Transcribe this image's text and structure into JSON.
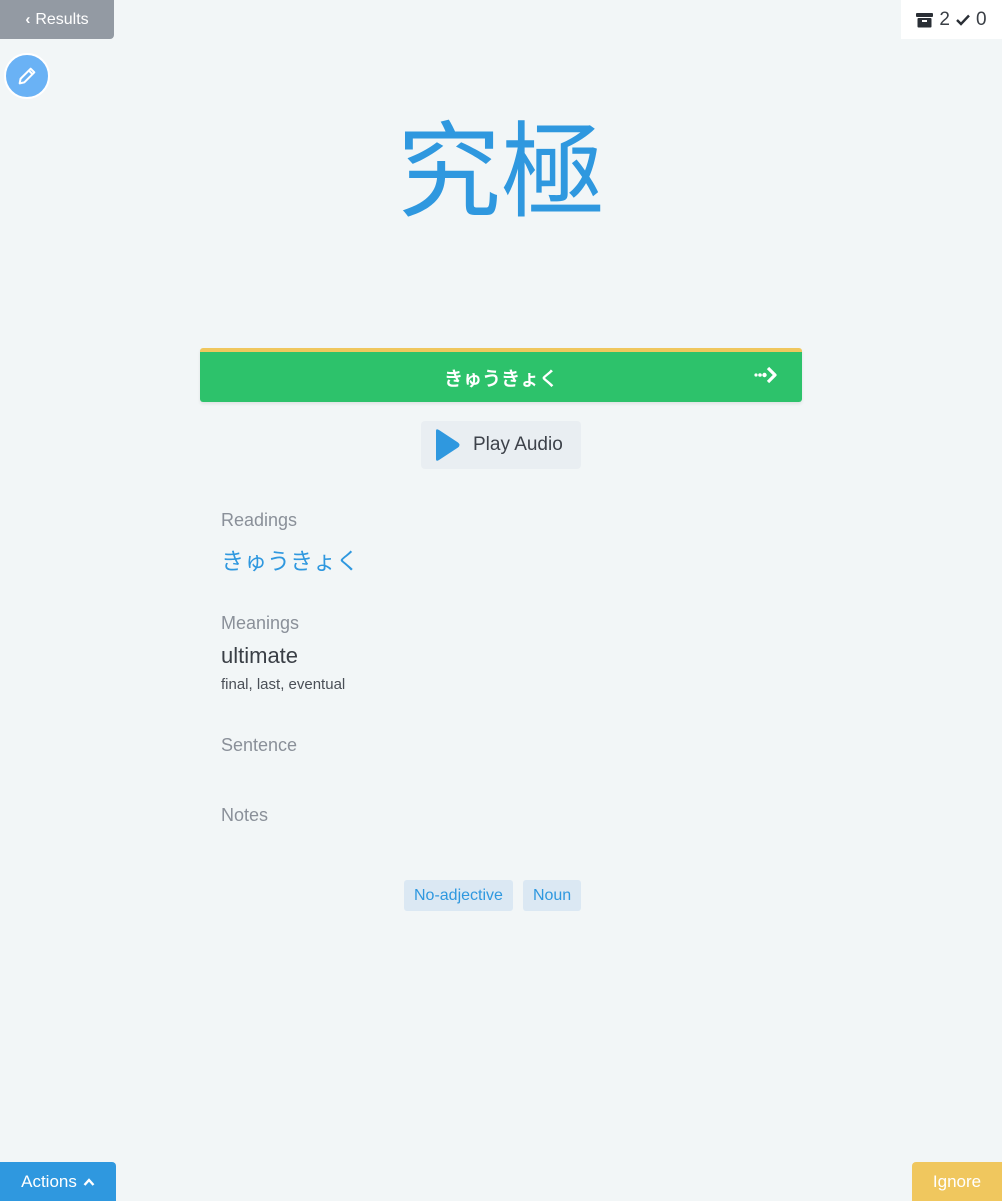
{
  "nav": {
    "back_label": "Results"
  },
  "counters": {
    "archive_count": "2",
    "check_count": "0"
  },
  "word": {
    "kanji": "究極"
  },
  "answer": {
    "text": "きゅうきょく"
  },
  "audio": {
    "label": "Play Audio"
  },
  "sections": {
    "readings_label": "Readings",
    "reading_value": "きゅうきょく",
    "meanings_label": "Meanings",
    "meaning_main": "ultimate",
    "meaning_alt": "final, last, eventual",
    "sentence_label": "Sentence",
    "notes_label": "Notes"
  },
  "tags": [
    {
      "label": "No-adjective"
    },
    {
      "label": "Noun"
    }
  ],
  "footer": {
    "actions_label": "Actions",
    "ignore_label": "Ignore"
  },
  "colors": {
    "accent_blue": "#2f98df",
    "answer_green": "#2dc26b",
    "warning_yellow": "#f0c75e",
    "back_gray": "#939aa3"
  },
  "icons": {
    "back": "chevron-left-icon",
    "edit": "pencil-icon",
    "archive": "archive-icon",
    "check": "check-icon",
    "next": "arrow-right-icon",
    "play": "play-icon",
    "actions": "chevron-up-icon"
  }
}
